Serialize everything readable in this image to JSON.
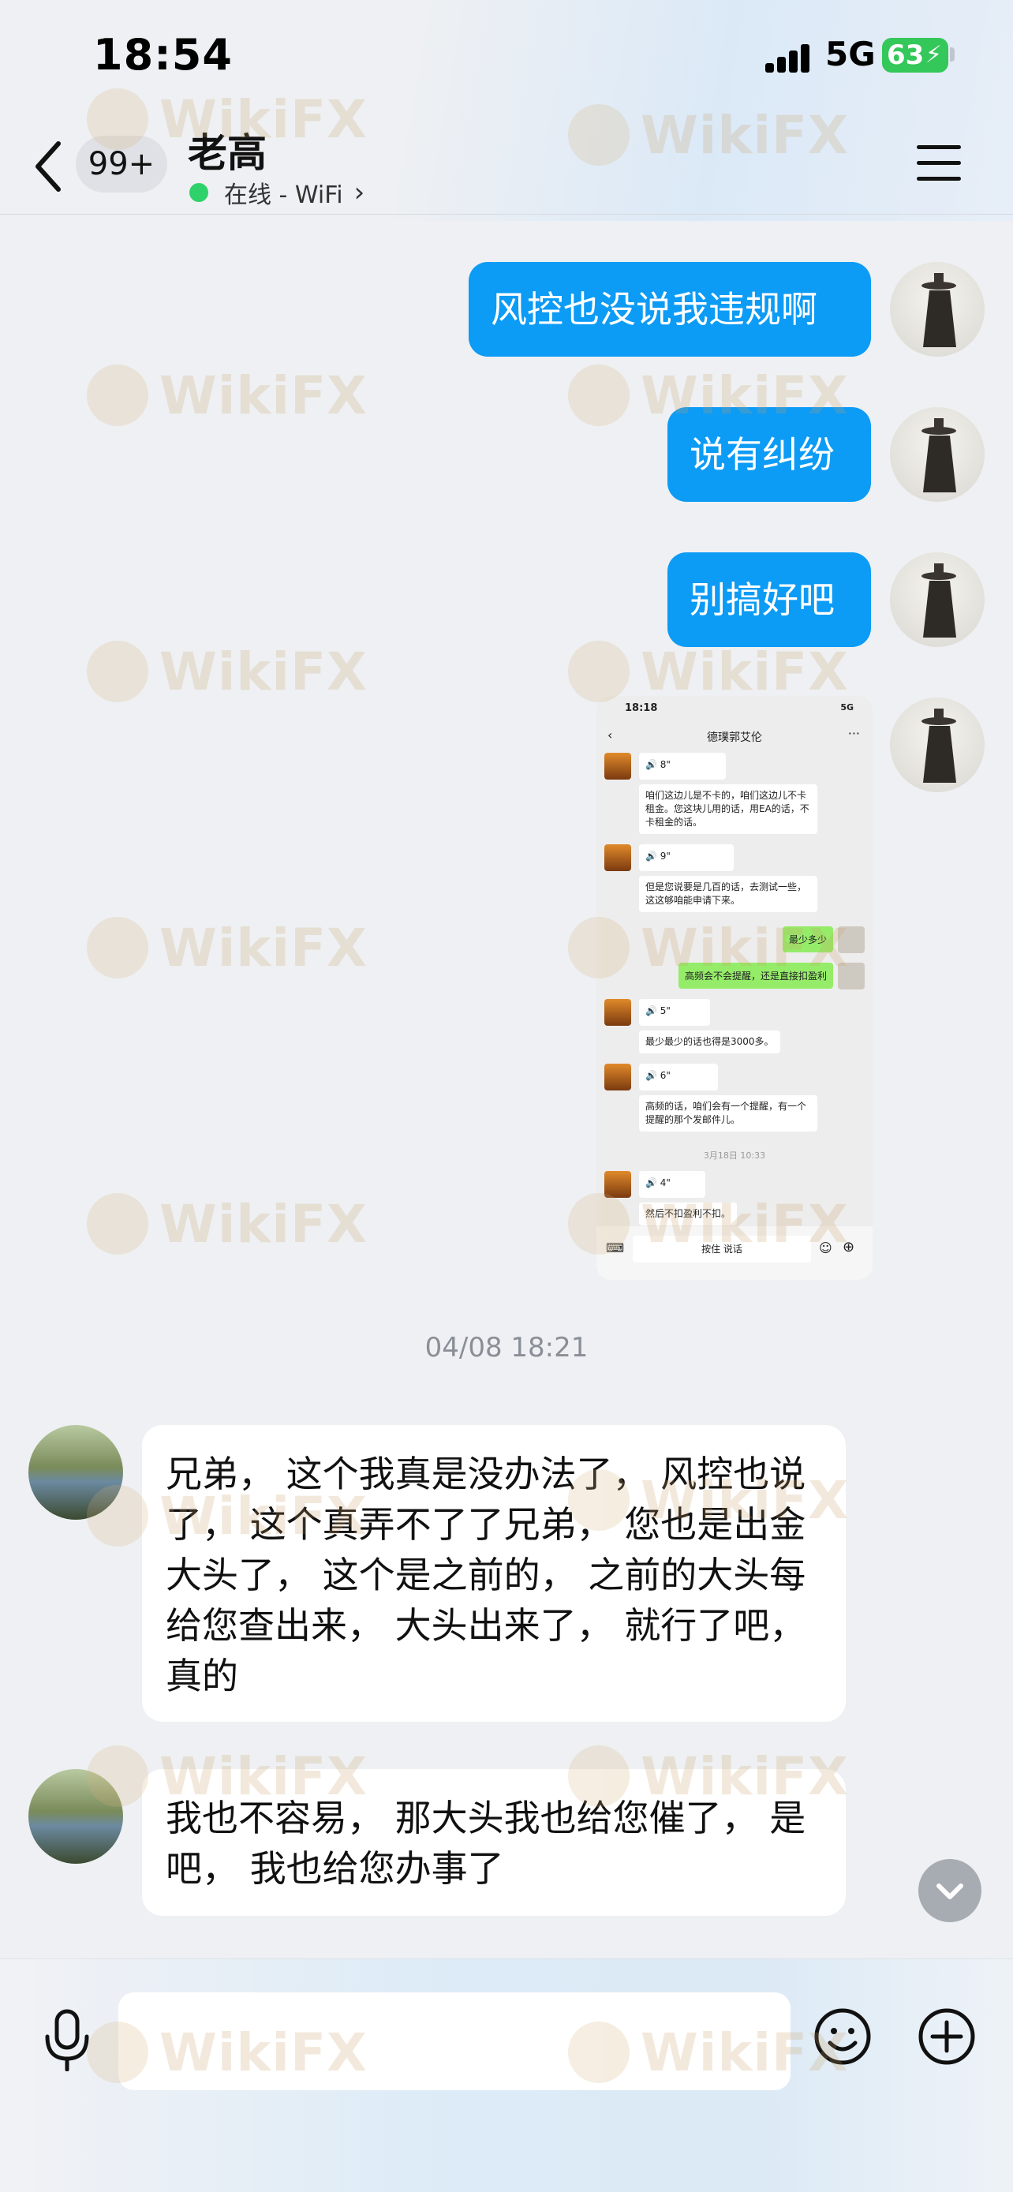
{
  "status_bar": {
    "time": "18:54",
    "network": "5G",
    "battery": "63"
  },
  "nav": {
    "badge": "99+",
    "contact_name": "老高",
    "presence": "在线 - WiFi"
  },
  "messages": {
    "out_1": "风控也没说我违规啊",
    "out_2": "说有纠纷",
    "out_3": "别搞好吧",
    "timestamp": "04/08 18:21",
    "in_1": "兄弟， 这个我真是没办法了， 风控也说了， 这个真弄不了了兄弟， 您也是出金大头了， 这个是之前的， 之前的大头每给您查出来， 大头出来了， 就行了吧， 真的",
    "in_2": "我也不容易， 那大头我也给您催了， 是吧， 我也给您办事了"
  },
  "screenshot": {
    "time": "18:18",
    "network": "5G",
    "title": "德璞郭艾伦",
    "voice_1": "8\"",
    "text_1": "咱们这边儿是不卡的，咱们这边儿不卡租金。您这块儿用的话，用EA的话，不卡租金的话。",
    "voice_2": "9\"",
    "text_2": "但是您说要是几百的话，去测试一些，这这够咱能申请下来。",
    "green_1": "最少多少",
    "green_2": "高频会不会提醒，还是直接扣盈利",
    "voice_3": "5\"",
    "text_3": "最少最少的话也得是3000多。",
    "voice_4": "6\"",
    "text_4": "高频的话，咱们会有一个提醒，有一个提醒的那个发邮件儿。",
    "ts": "3月18日 10:33",
    "voice_5": "4\"",
    "text_5": "然后不扣盈利不扣。",
    "hold_to_talk": "按住 说话"
  },
  "watermark": "WikiFX",
  "colors": {
    "outgoing_bubble": "#0c9bf5",
    "incoming_bubble": "#ffffff",
    "online_dot": "#2fd26a",
    "battery": "#34c759"
  }
}
